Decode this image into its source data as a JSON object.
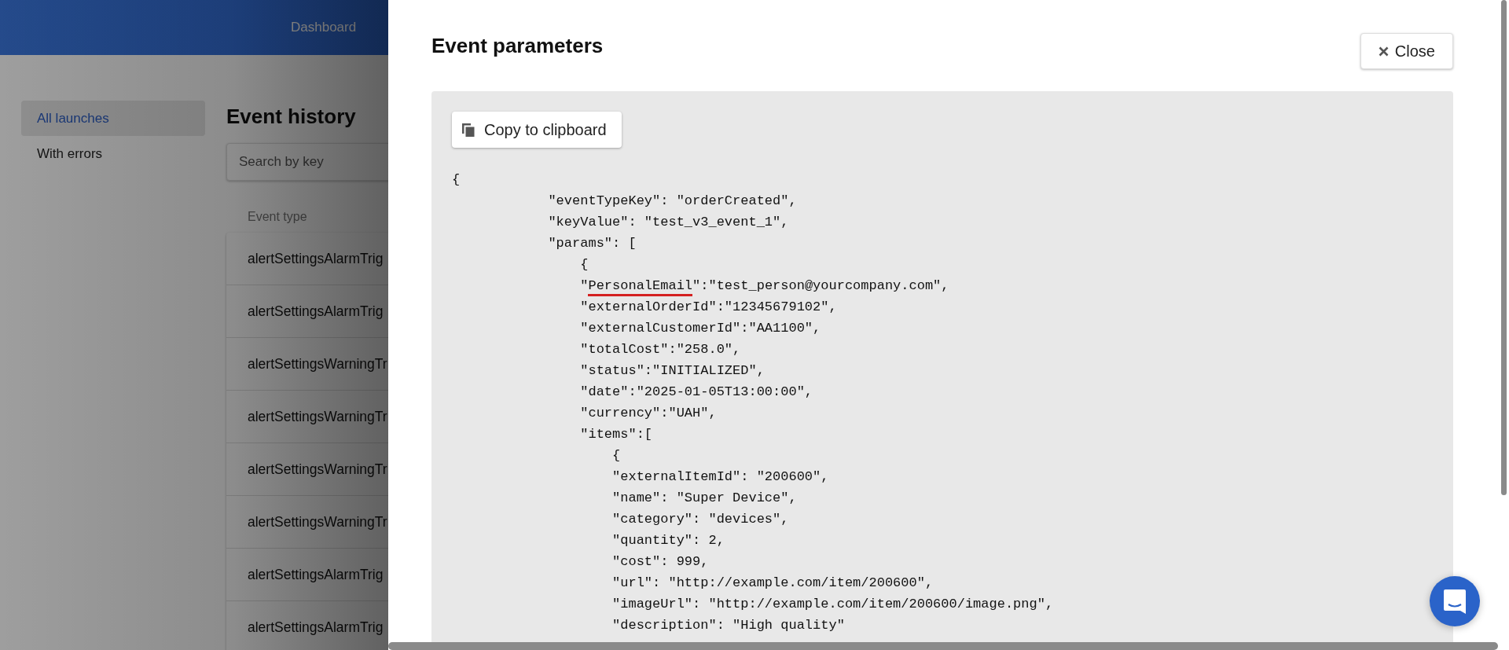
{
  "header": {
    "nav": [
      "Dashboard"
    ]
  },
  "sidebar": {
    "items": [
      {
        "label": "All launches",
        "selected": true
      },
      {
        "label": "With errors",
        "selected": false
      }
    ]
  },
  "page": {
    "title": "Event history",
    "search": {
      "placeholder": "Search by key"
    },
    "table": {
      "columns": [
        "Event type"
      ],
      "rows": [
        "alertSettingsAlarmTrig",
        "alertSettingsAlarmTrig",
        "alertSettingsWarningTr",
        "alertSettingsWarningTr",
        "alertSettingsWarningTr",
        "alertSettingsWarningTr",
        "alertSettingsAlarmTrig",
        "alertSettingsAlarmTrig"
      ]
    }
  },
  "modal": {
    "title": "Event parameters",
    "close_button": "Close",
    "copy_button": "Copy to clipboard",
    "code_lines": [
      {
        "text": "{"
      },
      {
        "text": "            \"eventTypeKey\": \"orderCreated\","
      },
      {
        "text": "            \"keyValue\": \"test_v3_event_1\","
      },
      {
        "text": "            \"params\": ["
      },
      {
        "text": "                {"
      },
      {
        "parts": [
          {
            "text": "                \"",
            "underlined": false
          },
          {
            "text": "PersonalEmail",
            "underlined": true
          },
          {
            "text": "\":\"test_person@yourcompany.com\",",
            "underlined": false
          }
        ]
      },
      {
        "text": "                \"externalOrderId\":\"12345679102\","
      },
      {
        "text": "                \"externalCustomerId\":\"AA1100\","
      },
      {
        "text": "                \"totalCost\":\"258.0\","
      },
      {
        "text": "                \"status\":\"INITIALIZED\","
      },
      {
        "text": "                \"date\":\"2025-01-05T13:00:00\","
      },
      {
        "text": "                \"currency\":\"UAH\","
      },
      {
        "text": "                \"items\":["
      },
      {
        "text": "                    {"
      },
      {
        "text": "                    \"externalItemId\": \"200600\","
      },
      {
        "text": "                    \"name\": \"Super Device\","
      },
      {
        "text": "                    \"category\": \"devices\","
      },
      {
        "text": "                    \"quantity\": 2,"
      },
      {
        "text": "                    \"cost\": 999,"
      },
      {
        "text": "                    \"url\": \"http://example.com/item/200600\","
      },
      {
        "text": "                    \"imageUrl\": \"http://example.com/item/200600/image.png\","
      },
      {
        "text": "                    \"description\": \"High quality\""
      }
    ]
  }
}
